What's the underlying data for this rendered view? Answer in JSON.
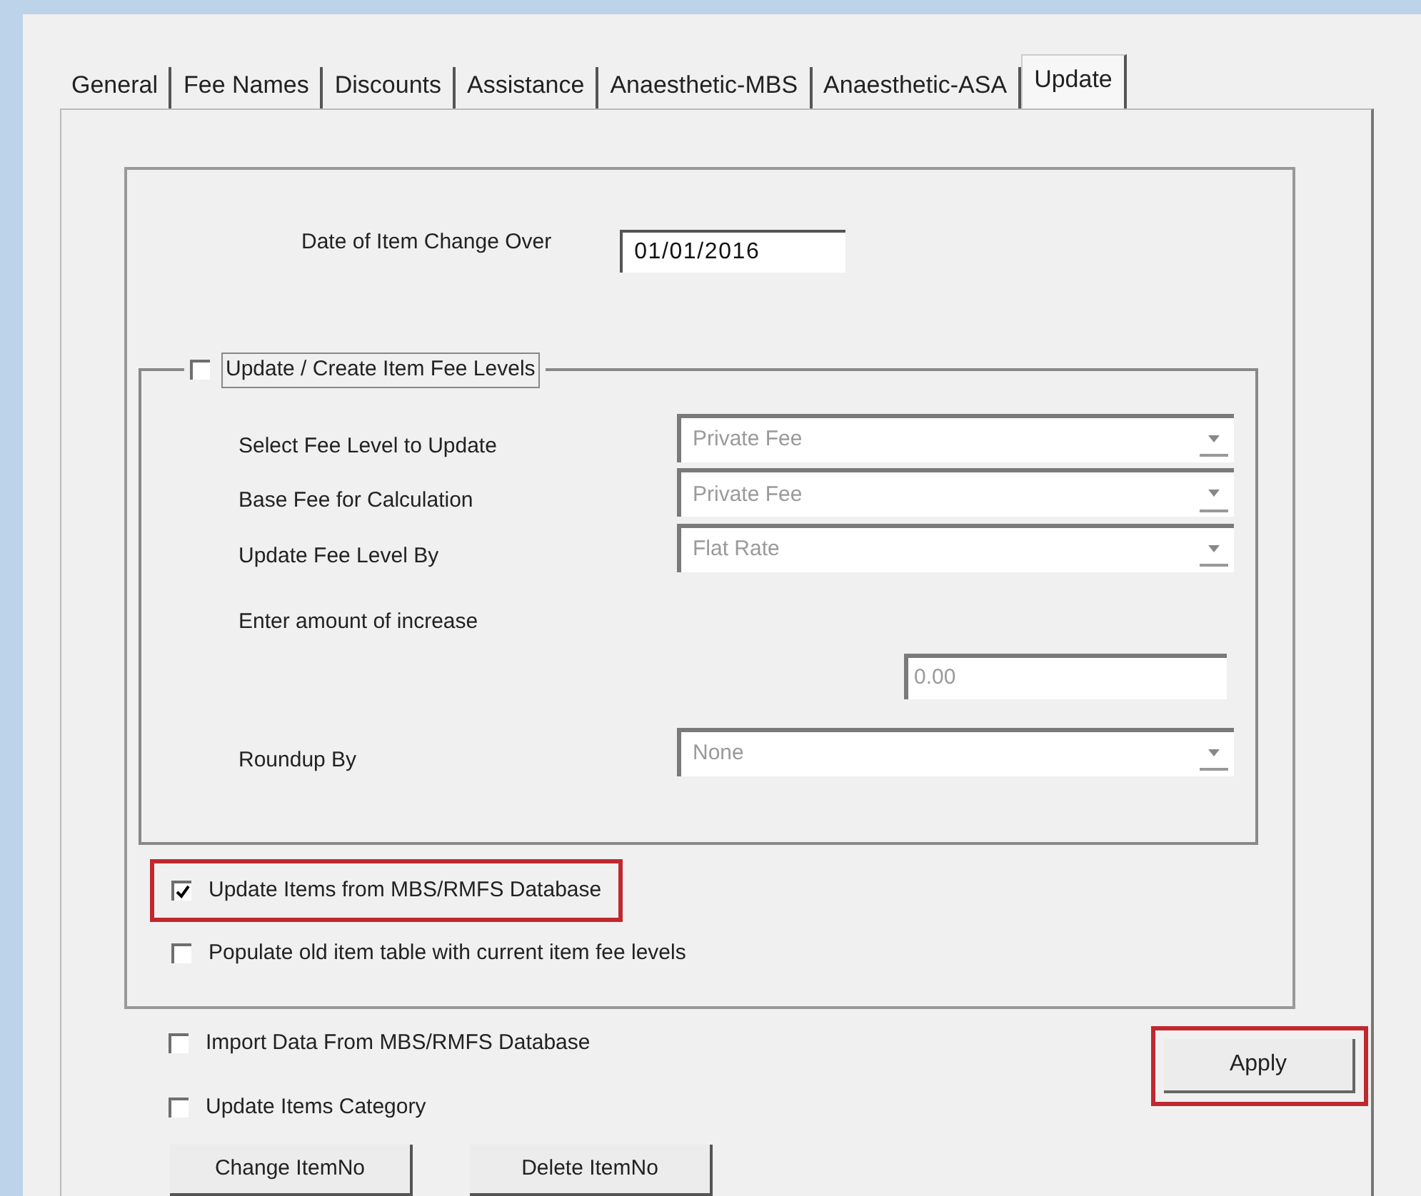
{
  "tabs": [
    {
      "label": "General",
      "selected": false
    },
    {
      "label": "Fee Names",
      "selected": false
    },
    {
      "label": "Discounts",
      "selected": false
    },
    {
      "label": "Assistance",
      "selected": false
    },
    {
      "label": "Anaesthetic-MBS",
      "selected": false
    },
    {
      "label": "Anaesthetic-ASA",
      "selected": false
    },
    {
      "label": "Update",
      "selected": true
    }
  ],
  "change_over": {
    "label": "Date of Item Change Over",
    "value": "01/01/2016"
  },
  "fee_group": {
    "label": "Update / Create Item Fee Levels",
    "checked": false,
    "fields": [
      {
        "kind": "dropdown",
        "label": "Select Fee Level to Update",
        "value": "Private Fee",
        "disabled": true
      },
      {
        "kind": "dropdown",
        "label": "Base Fee for Calculation",
        "value": "Private Fee",
        "disabled": true
      },
      {
        "kind": "dropdown",
        "label": "Update Fee Level By",
        "value": "Flat Rate",
        "disabled": true
      },
      {
        "kind": "text",
        "label": "Enter amount of increase",
        "value": "0.00",
        "disabled": true
      },
      {
        "kind": "dropdown",
        "label": "Roundup By",
        "value": "None",
        "disabled": true
      }
    ]
  },
  "inner_options": [
    {
      "label": "Update Items from MBS/RMFS Database",
      "checked": true,
      "highlighted": true
    },
    {
      "label": "Populate old item table with current item fee levels",
      "checked": false,
      "highlighted": false
    }
  ],
  "outer_options": [
    {
      "label": "Import Data From MBS/RMFS Database",
      "checked": false,
      "highlighted": false
    },
    {
      "label": "Update Items Category",
      "checked": false,
      "highlighted": false
    }
  ],
  "apply_button": {
    "label": "Apply",
    "highlighted": true
  },
  "bottom_buttons": [
    {
      "label": "Change ItemNo"
    },
    {
      "label": "Delete ItemNo"
    }
  ]
}
